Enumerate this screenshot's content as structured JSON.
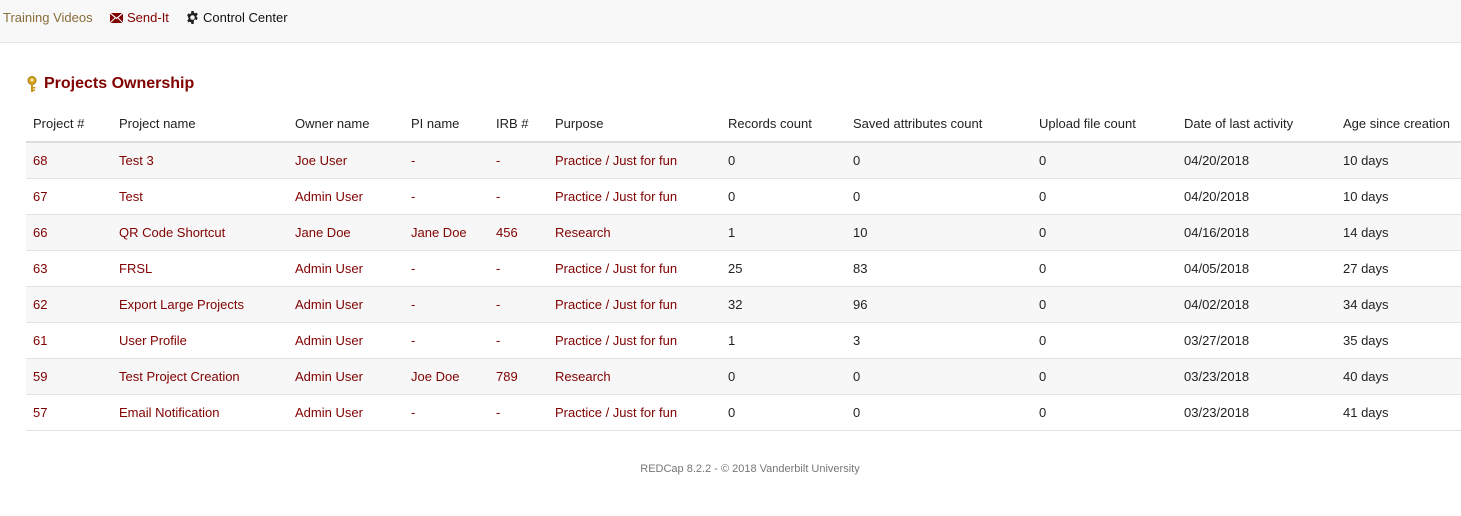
{
  "nav": {
    "training_label": "Training Videos",
    "sendit_label": "Send-It",
    "control_label": "Control Center"
  },
  "page": {
    "title": "Projects Ownership"
  },
  "table": {
    "headers": [
      "Project #",
      "Project name",
      "Owner name",
      "PI name",
      "IRB #",
      "Purpose",
      "Records count",
      "Saved attributes count",
      "Upload file count",
      "Date of last activity",
      "Age since creation"
    ],
    "rows": [
      [
        "68",
        "Test 3",
        "Joe User",
        "-",
        "-",
        "Practice / Just for fun",
        "0",
        "0",
        "0",
        "04/20/2018",
        "10 days"
      ],
      [
        "67",
        "Test",
        "Admin User",
        "-",
        "-",
        "Practice / Just for fun",
        "0",
        "0",
        "0",
        "04/20/2018",
        "10 days"
      ],
      [
        "66",
        "QR Code Shortcut",
        "Jane Doe",
        "Jane Doe",
        "456",
        "Research",
        "1",
        "10",
        "0",
        "04/16/2018",
        "14 days"
      ],
      [
        "63",
        "FRSL",
        "Admin User",
        "-",
        "-",
        "Practice / Just for fun",
        "25",
        "83",
        "0",
        "04/05/2018",
        "27 days"
      ],
      [
        "62",
        "Export Large Projects",
        "Admin User",
        "-",
        "-",
        "Practice / Just for fun",
        "32",
        "96",
        "0",
        "04/02/2018",
        "34 days"
      ],
      [
        "61",
        "User Profile",
        "Admin User",
        "-",
        "-",
        "Practice / Just for fun",
        "1",
        "3",
        "0",
        "03/27/2018",
        "35 days"
      ],
      [
        "59",
        "Test Project Creation",
        "Admin User",
        "Joe Doe",
        "789",
        "Research",
        "0",
        "0",
        "0",
        "03/23/2018",
        "40 days"
      ],
      [
        "57",
        "Email Notification",
        "Admin User",
        "-",
        "-",
        "Practice / Just for fun",
        "0",
        "0",
        "0",
        "03/23/2018",
        "41 days"
      ]
    ]
  },
  "footer": {
    "text": "REDCap 8.2.2 - © 2018 Vanderbilt University"
  },
  "colors": {
    "accent": "#800000",
    "topbar_bg": "#f8f8f8",
    "row_stripe": "#f7f7f7"
  },
  "icons": {
    "sendit": "envelope-icon",
    "control": "gear-icon",
    "title": "key-icon"
  }
}
